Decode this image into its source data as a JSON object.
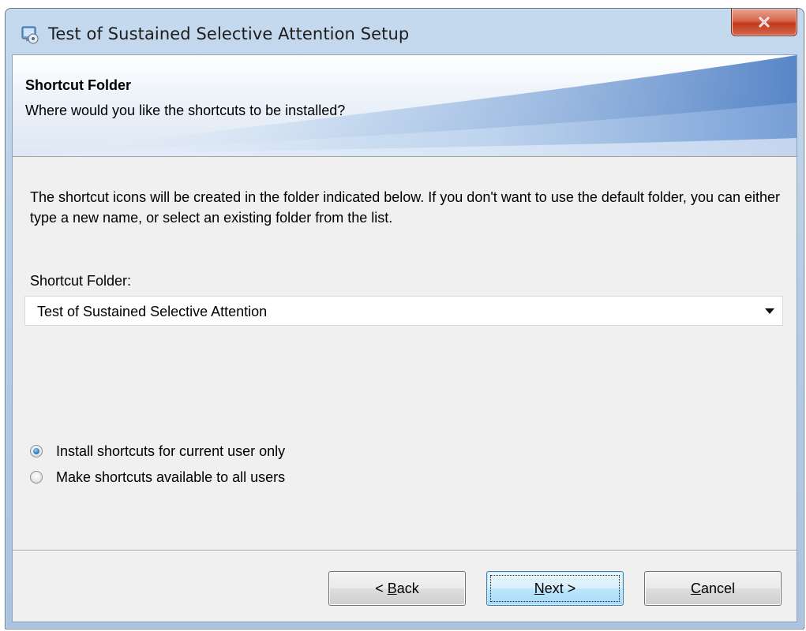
{
  "window": {
    "title": "Test of Sustained Selective Attention Setup",
    "app_icon": "installer-icon",
    "close_icon": "close-x-icon"
  },
  "banner": {
    "title": "Shortcut Folder",
    "subtitle": "Where would you like the shortcuts to be installed?"
  },
  "description": "The shortcut icons will be created in the folder indicated below. If you don't want to use the default folder, you can either type a new name, or select an existing folder from the list.",
  "shortcut_folder": {
    "label": "Shortcut Folder:",
    "value": "Test of Sustained Selective Attention",
    "arrow_icon": "chevron-down-icon"
  },
  "install_scope": {
    "options": [
      {
        "label": "Install shortcuts for current user only",
        "checked": true
      },
      {
        "label": "Make shortcuts available to all users",
        "checked": false
      }
    ]
  },
  "buttons": {
    "back": {
      "prefix": "< ",
      "accel": "B",
      "rest": "ack"
    },
    "next": {
      "accel": "N",
      "rest": "ext >"
    },
    "cancel": {
      "accel": "C",
      "rest": "ancel"
    }
  },
  "colors": {
    "titlebar": "#b3cbe6",
    "close_button": "#c4391c",
    "dialog_bg": "#f0f0f0",
    "radio_selected": "#2f7cc5",
    "default_button": "#3c7fb1"
  }
}
